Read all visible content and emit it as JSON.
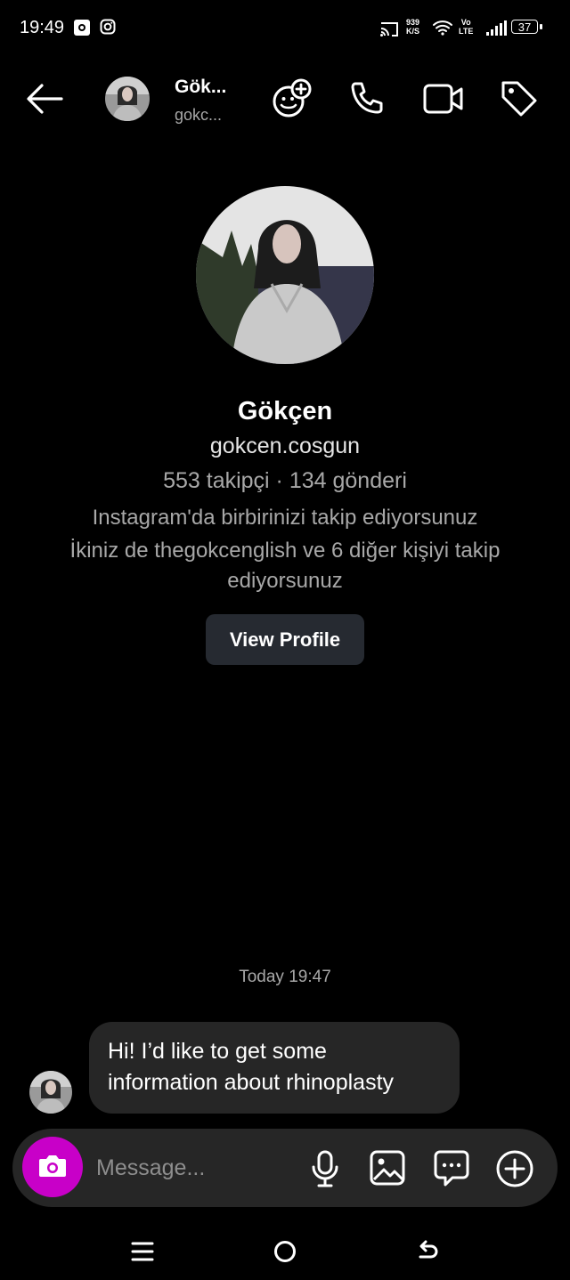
{
  "status_bar": {
    "time": "19:49",
    "net_speed_value": "939",
    "net_speed_unit": "K/S",
    "volte_top": "Vo",
    "volte_bottom": "LTE",
    "battery": "37"
  },
  "header": {
    "name": "Gök...",
    "username": "gokc..."
  },
  "profile": {
    "name": "Gökçen",
    "username": "gokcen.cosgun",
    "stats": "553 takipçi · 134 gönderi",
    "mutual_follow": "Instagram'da birbirinizi takip ediyorsunuz",
    "common_follow": "İkiniz de thegokcenglish ve 6 diğer kişiyi takip ediyorsunuz",
    "view_profile_label": "View Profile"
  },
  "conversation": {
    "timestamp": "Today 19:47",
    "messages": [
      {
        "text": "Hi! I’d like to get some information about rhinoplasty"
      }
    ]
  },
  "composer": {
    "placeholder": "Message..."
  },
  "icons": {
    "back": "arrow-left-icon",
    "effects": "face-plus-icon",
    "call": "phone-icon",
    "video": "video-camera-icon",
    "tag": "tag-icon",
    "camera": "camera-icon",
    "mic": "microphone-icon",
    "gallery": "image-icon",
    "sticker": "chat-bubble-icon",
    "add": "plus-circle-icon"
  },
  "colors": {
    "background": "#000000",
    "camera_button": "#c800c8",
    "bubble": "#262626",
    "button": "#262a31"
  }
}
